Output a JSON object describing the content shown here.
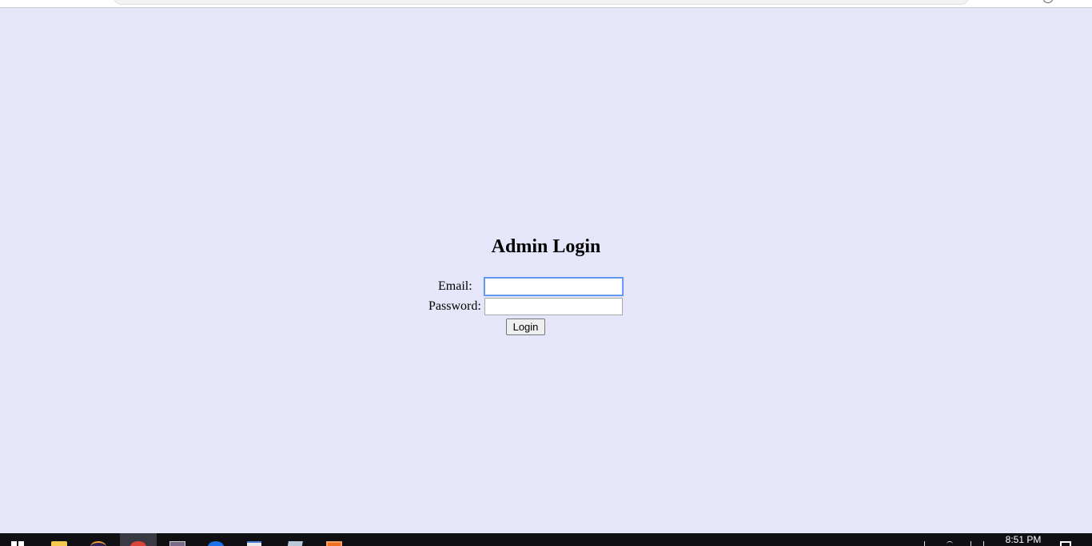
{
  "page": {
    "title": "Admin Login",
    "background_color": "#e6e6fa"
  },
  "form": {
    "email_label": "Email:",
    "email_value": "",
    "email_placeholder": "",
    "password_label": "Password:",
    "password_value": "",
    "password_placeholder": "",
    "login_label": "Login"
  },
  "taskbar": {
    "icons": [
      "start-icon",
      "folder-icon",
      "eclipse-icon",
      "chrome-icon",
      "calendar-icon",
      "edge-icon",
      "notepad-icon",
      "docs-icon",
      "app-icon"
    ],
    "clock_time": "8:51 PM"
  }
}
